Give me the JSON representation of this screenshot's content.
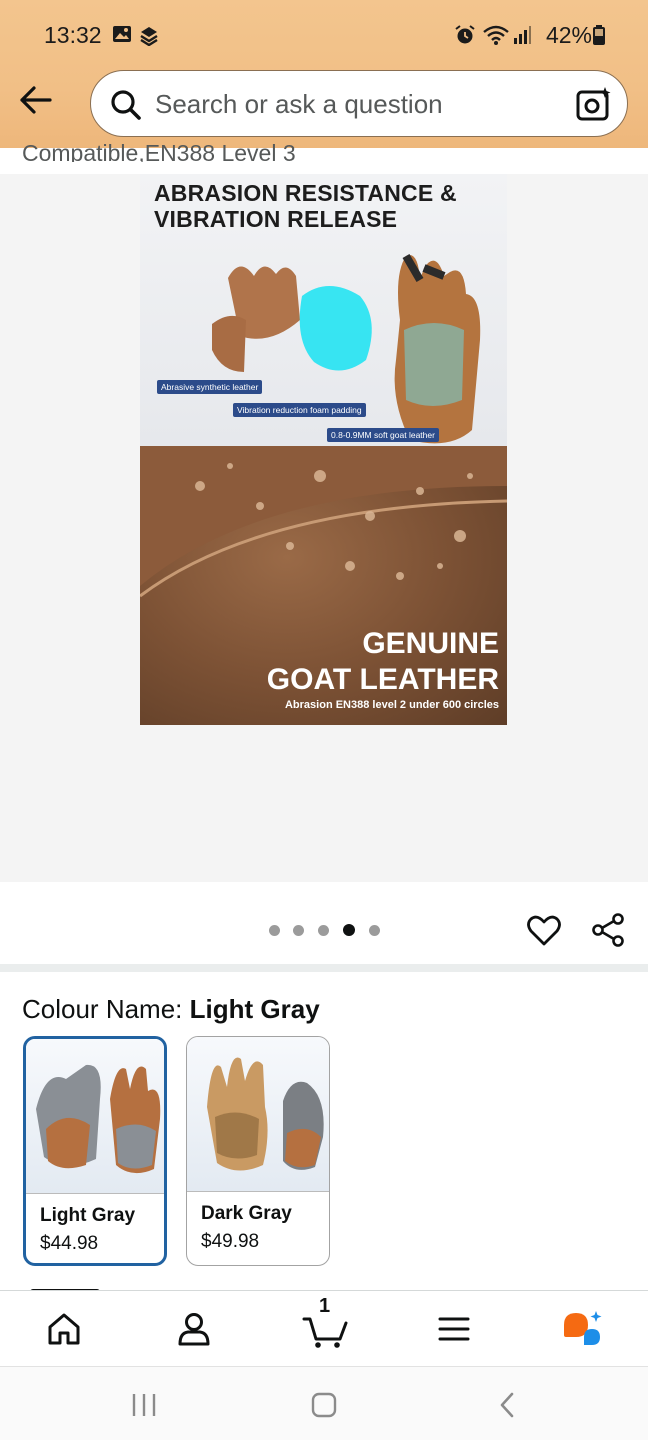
{
  "status_bar": {
    "time": "13:32",
    "battery": "42%",
    "icons": [
      "gallery-icon",
      "app-icon",
      "alarm-icon",
      "wifi-icon",
      "signal-icon",
      "battery-icon"
    ]
  },
  "header": {
    "back_icon": "arrow-left-icon",
    "search_placeholder": "Search or ask a question",
    "camera_icon": "camera-search-icon"
  },
  "product": {
    "title_fragment": "Compatible,EN388 Level 3",
    "image": {
      "headline": "ABRASION RESISTANCE & VIBRATION RELEASE",
      "label1": "Abrasive synthetic leather",
      "label2": "Vibration reduction foam padding",
      "label3": "0.8-0.9MM soft goat leather",
      "big1": "GENUINE",
      "big2": "GOAT LEATHER",
      "caption": "Abrasion EN388 level 2 under 600 circles"
    },
    "carousel": {
      "count": 5,
      "active_index": 3
    }
  },
  "colour": {
    "label": "Colour Name:",
    "selected": "Light Gray",
    "options": [
      {
        "name": "Light Gray",
        "price": "$44.98"
      },
      {
        "name": "Dark Gray",
        "price": "$49.98"
      }
    ]
  },
  "bottom_nav": {
    "items": [
      "home-icon",
      "account-icon",
      "cart-icon",
      "menu-icon",
      "rufus-icon"
    ],
    "cart_count": "1"
  },
  "colors": {
    "accent_blue": "#2162a1",
    "header_bg": "#f1bf86",
    "rufus_orange": "#f56a12",
    "rufus_blue": "#1d8ee8"
  }
}
